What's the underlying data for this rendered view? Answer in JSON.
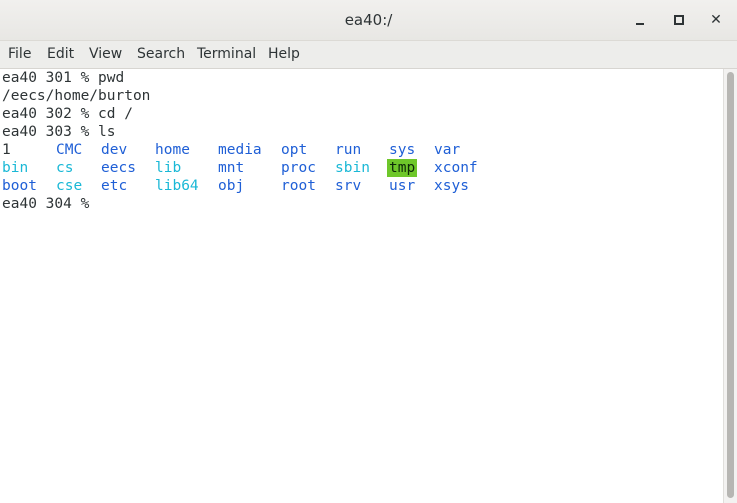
{
  "window": {
    "title": "ea40:/",
    "controls": {
      "minimize": "minimize-icon",
      "maximize": "maximize-icon",
      "close": "close-icon"
    }
  },
  "menu": {
    "file": "File",
    "edit": "Edit",
    "view": "View",
    "search": "Search",
    "terminal": "Terminal",
    "help": "Help"
  },
  "terminal": {
    "lines": [
      "ea40 301 % pwd",
      "/eecs/home/burton",
      "ea40 302 % cd /",
      "ea40 303 % ls",
      "ea40 304 % "
    ],
    "ls_rows": [
      [
        "1",
        "CMC",
        "dev",
        "home",
        "media",
        "opt",
        "run",
        "sys",
        "var"
      ],
      [
        "bin",
        "cs",
        "eecs",
        "lib",
        "mnt",
        "proc",
        "sbin",
        "tmp",
        "xconf"
      ],
      [
        "boot",
        "cse",
        "etc",
        "lib64",
        "obj",
        "root",
        "srv",
        "usr",
        "xsys"
      ]
    ],
    "colors": {
      "directory": "#1f5fd6",
      "symlink": "#1ab8d6",
      "sticky_highlight": "#6ec72a",
      "text": "#2e3436"
    }
  }
}
